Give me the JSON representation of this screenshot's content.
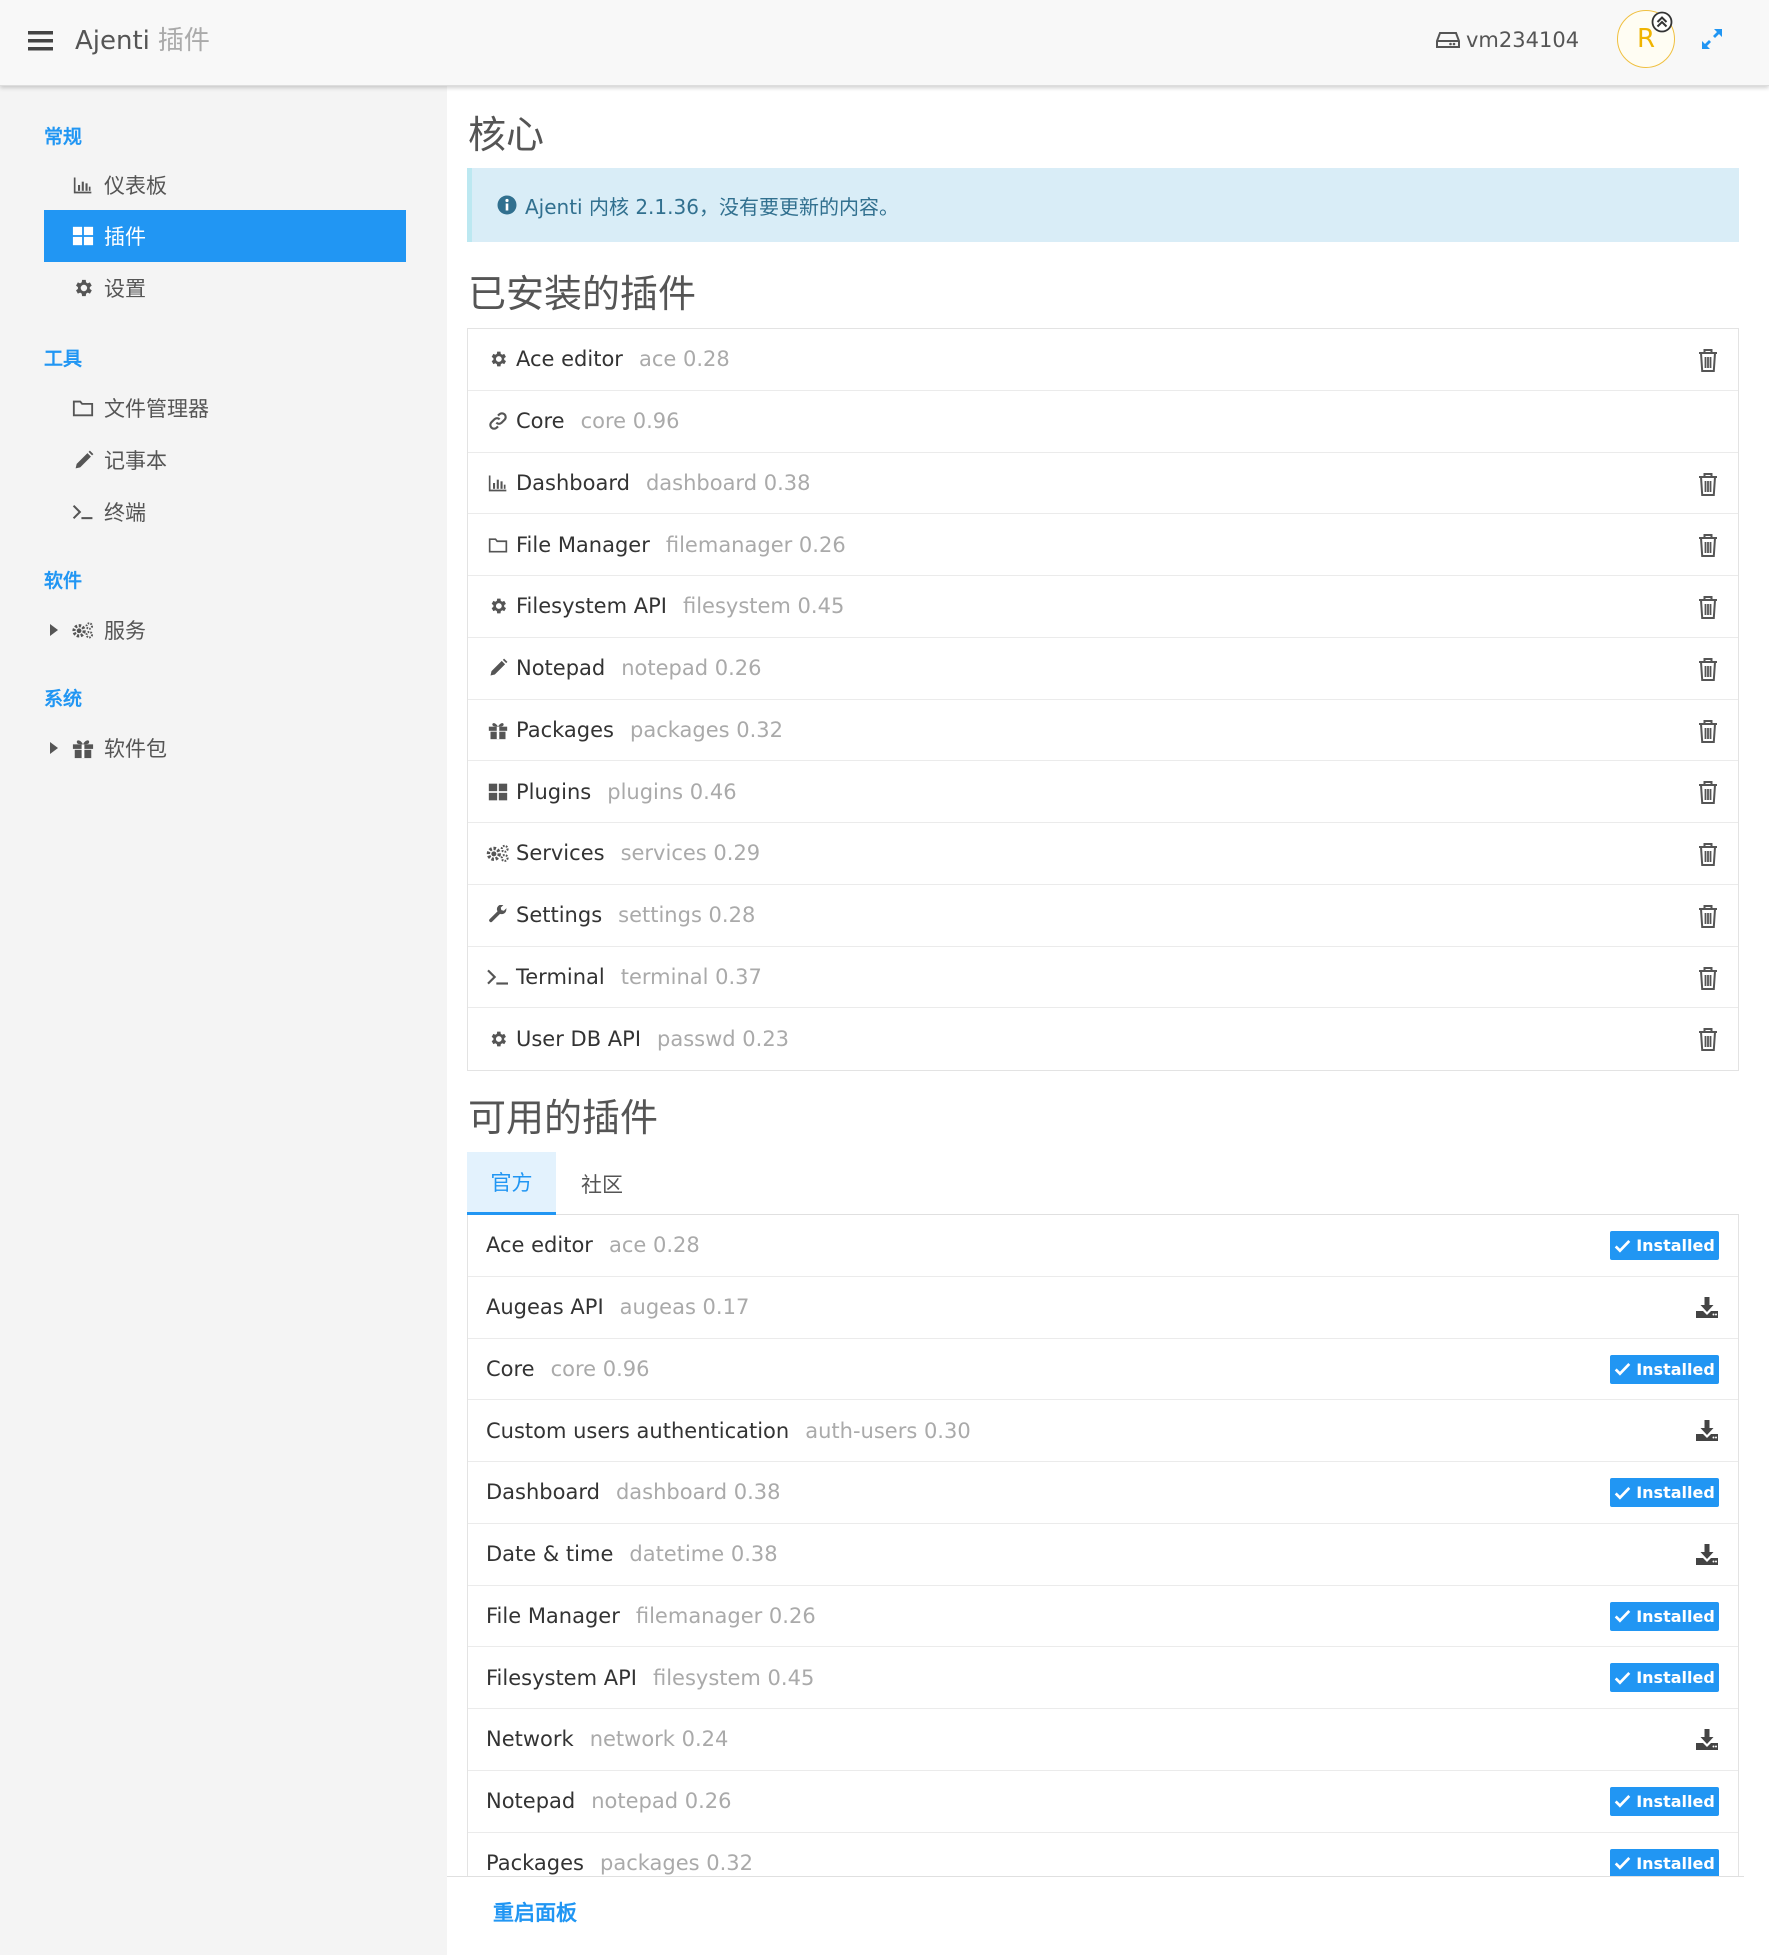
{
  "header": {
    "title": "Ajenti",
    "page": "插件",
    "host": "vm234104",
    "avatar_letter": "R"
  },
  "sidebar": {
    "sections": [
      {
        "label": "常规",
        "items": [
          {
            "label": "仪表板",
            "icon": "bar-chart-icon"
          },
          {
            "label": "插件",
            "icon": "grid-icon",
            "active": true
          },
          {
            "label": "设置",
            "icon": "gear-icon"
          }
        ]
      },
      {
        "label": "工具",
        "items": [
          {
            "label": "文件管理器",
            "icon": "folder-icon"
          },
          {
            "label": "记事本",
            "icon": "pencil-icon"
          },
          {
            "label": "终端",
            "icon": "terminal-icon"
          }
        ]
      },
      {
        "label": "软件",
        "items": [
          {
            "label": "服务",
            "icon": "gears-icon",
            "expandable": true
          }
        ]
      },
      {
        "label": "系统",
        "items": [
          {
            "label": "软件包",
            "icon": "gift-icon",
            "expandable": true
          }
        ]
      }
    ]
  },
  "main": {
    "core_title": "核心",
    "core_alert": "Ajenti 内核 2.1.36，没有要更新的内容。",
    "installed_title": "已安装的插件",
    "installed": [
      {
        "name": "Ace editor",
        "version": "ace 0.28",
        "icon": "gear-icon",
        "removable": true
      },
      {
        "name": "Core",
        "version": "core 0.96",
        "icon": "link-icon",
        "removable": false
      },
      {
        "name": "Dashboard",
        "version": "dashboard 0.38",
        "icon": "bar-chart-icon",
        "removable": true
      },
      {
        "name": "File Manager",
        "version": "filemanager 0.26",
        "icon": "folder-icon",
        "removable": true
      },
      {
        "name": "Filesystem API",
        "version": "filesystem 0.45",
        "icon": "gear-icon",
        "removable": true
      },
      {
        "name": "Notepad",
        "version": "notepad 0.26",
        "icon": "pencil-icon",
        "removable": true
      },
      {
        "name": "Packages",
        "version": "packages 0.32",
        "icon": "gift-icon",
        "removable": true
      },
      {
        "name": "Plugins",
        "version": "plugins 0.46",
        "icon": "grid-icon",
        "removable": true
      },
      {
        "name": "Services",
        "version": "services 0.29",
        "icon": "gears-icon",
        "removable": true
      },
      {
        "name": "Settings",
        "version": "settings 0.28",
        "icon": "wrench-icon",
        "removable": true
      },
      {
        "name": "Terminal",
        "version": "terminal 0.37",
        "icon": "terminal-icon",
        "removable": true
      },
      {
        "name": "User DB API",
        "version": "passwd 0.23",
        "icon": "gear-icon",
        "removable": true
      }
    ],
    "available_title": "可用的插件",
    "tabs": {
      "official": "官方",
      "community": "社区"
    },
    "installed_badge": "Installed",
    "available": [
      {
        "name": "Ace editor",
        "version": "ace 0.28",
        "installed": true
      },
      {
        "name": "Augeas API",
        "version": "augeas 0.17",
        "installed": false
      },
      {
        "name": "Core",
        "version": "core 0.96",
        "installed": true
      },
      {
        "name": "Custom users authentication",
        "version": "auth-users 0.30",
        "installed": false
      },
      {
        "name": "Dashboard",
        "version": "dashboard 0.38",
        "installed": true
      },
      {
        "name": "Date & time",
        "version": "datetime 0.38",
        "installed": false
      },
      {
        "name": "File Manager",
        "version": "filemanager 0.26",
        "installed": true
      },
      {
        "name": "Filesystem API",
        "version": "filesystem 0.45",
        "installed": true
      },
      {
        "name": "Network",
        "version": "network 0.24",
        "installed": false
      },
      {
        "name": "Notepad",
        "version": "notepad 0.26",
        "installed": true
      },
      {
        "name": "Packages",
        "version": "packages 0.32",
        "installed": true
      }
    ],
    "restart_label": "重启面板"
  },
  "colors": {
    "accent": "#2196f3",
    "alert_bg": "#d9edf7",
    "alert_text": "#31708f"
  }
}
